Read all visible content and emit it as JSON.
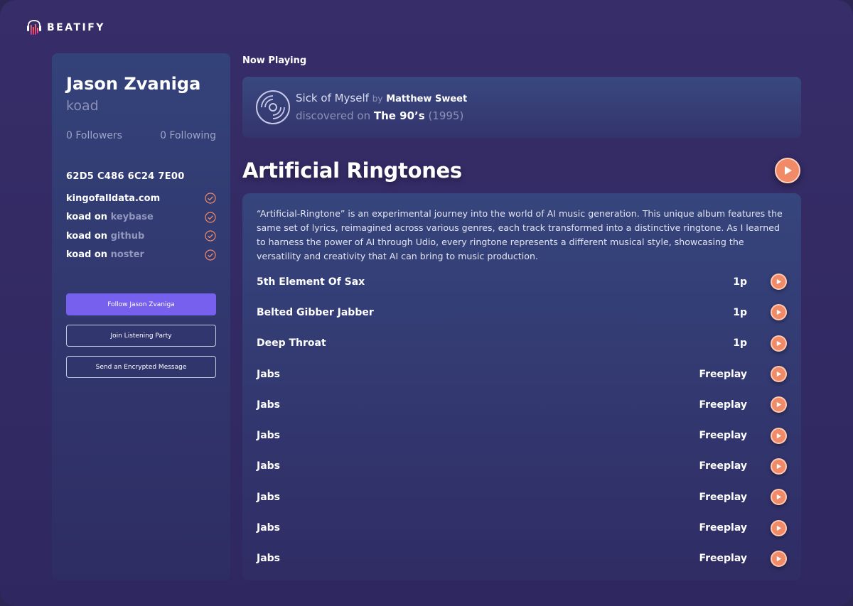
{
  "app": {
    "brand": "BEATIFY",
    "colors": {
      "accent": "#7760ee",
      "play": "#f08a67",
      "background": "#352c67"
    }
  },
  "profile": {
    "name": "Jason Zvaniga",
    "handle": "koad",
    "followers": "0 Followers",
    "following": "0 Following",
    "fingerprint": "62D5 C486 6C24 7E00",
    "identities": [
      {
        "name": "kingofalldata.com",
        "joiner": "",
        "service": ""
      },
      {
        "name": "koad",
        "joiner": " on ",
        "service": "keybase"
      },
      {
        "name": "koad",
        "joiner": " on ",
        "service": "github"
      },
      {
        "name": "koad",
        "joiner": " on ",
        "service": "noster"
      }
    ],
    "buttons": {
      "follow": "Follow Jason Zvaniga",
      "party": "Join Listening Party",
      "message": "Send an Encrypted Message"
    }
  },
  "now_playing": {
    "label": "Now Playing",
    "song": "Sick of Myself",
    "by": "by",
    "artist": "Matthew Sweet",
    "discovered": "discovered on",
    "era": "The 90’s",
    "year": "(1995)"
  },
  "album": {
    "title": "Artificial Ringtones",
    "description": "“Artificial-Ringtone” is an experimental journey into the world of AI music generation. This unique album features the same set of lyrics, reimagined across various genres, each track transformed into a distinctive ringtone. As I learned to harness the power of AI through Udio, every ringtone represents a different musical style, showcasing the versatility and creativity that AI can bring to music production.",
    "tracks": [
      {
        "title": "5th Element Of Sax",
        "price": "1p"
      },
      {
        "title": "Belted Gibber Jabber",
        "price": "1p"
      },
      {
        "title": "Deep Throat",
        "price": "1p"
      },
      {
        "title": "Jabs",
        "price": "Freeplay"
      },
      {
        "title": "Jabs",
        "price": "Freeplay"
      },
      {
        "title": "Jabs",
        "price": "Freeplay"
      },
      {
        "title": "Jabs",
        "price": "Freeplay"
      },
      {
        "title": "Jabs",
        "price": "Freeplay"
      },
      {
        "title": "Jabs",
        "price": "Freeplay"
      },
      {
        "title": "Jabs",
        "price": "Freeplay"
      }
    ]
  }
}
